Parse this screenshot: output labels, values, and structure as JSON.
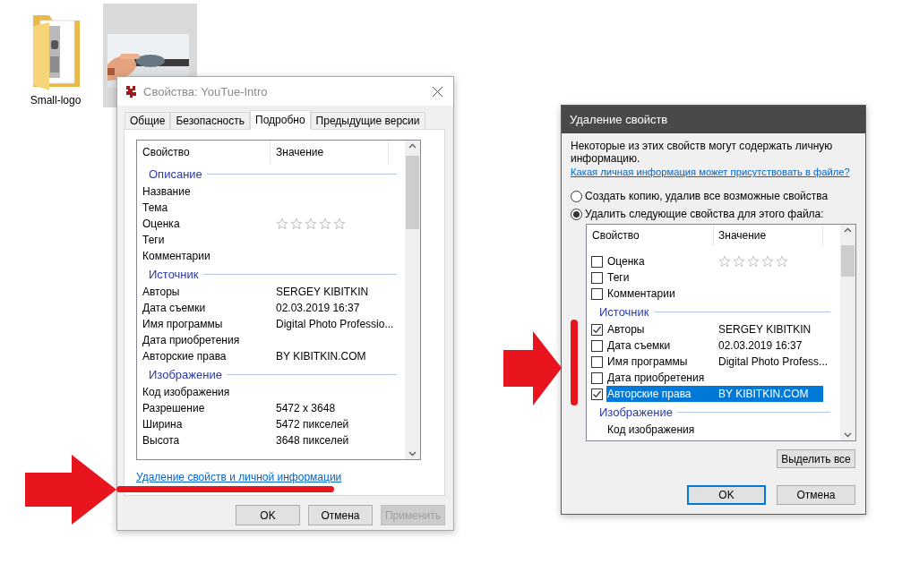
{
  "desktop": {
    "folder": {
      "label": "Small-logo"
    },
    "thumbnail": {
      "kind": "picture",
      "selected": true
    }
  },
  "properties_window": {
    "title": "Свойства: YouTue-Intro",
    "tabs": [
      {
        "label": "Общие",
        "selected": false
      },
      {
        "label": "Безопасность",
        "selected": false
      },
      {
        "label": "Подробно",
        "selected": true
      },
      {
        "label": "Предыдущие версии",
        "selected": false
      }
    ],
    "columns": [
      "Свойство",
      "Значение"
    ],
    "rows": [
      {
        "kind": "group",
        "label": "Описание"
      },
      {
        "kind": "property",
        "name": "Название"
      },
      {
        "kind": "property",
        "name": "Тема"
      },
      {
        "kind": "rating",
        "name": "Оценка",
        "stars": 0
      },
      {
        "kind": "property",
        "name": "Теги"
      },
      {
        "kind": "property",
        "name": "Комментарии"
      },
      {
        "kind": "group",
        "label": "Источник"
      },
      {
        "kind": "property",
        "name": "Авторы",
        "value": "SERGEY KIBITKIN"
      },
      {
        "kind": "property",
        "name": "Дата съемки",
        "value": "02.03.2019 16:37"
      },
      {
        "kind": "property",
        "name": "Имя программы",
        "value": "Digital Photo Professio..."
      },
      {
        "kind": "property",
        "name": "Дата приобретения"
      },
      {
        "kind": "property",
        "name": "Авторские права",
        "value": "BY KIBITKIN.COM"
      },
      {
        "kind": "group",
        "label": "Изображение"
      },
      {
        "kind": "property",
        "name": "Код изображения"
      },
      {
        "kind": "property",
        "name": "Разрешение",
        "value": "5472 x 3648"
      },
      {
        "kind": "property",
        "name": "Ширина",
        "value": "5472 пикселей"
      },
      {
        "kind": "property",
        "name": "Высота",
        "value": "3648 пикселей"
      }
    ],
    "link": "Удаление свойств и личной информации",
    "buttons": [
      {
        "label": "OK",
        "disabled": false
      },
      {
        "label": "Отмена",
        "disabled": false
      },
      {
        "label": "Применить",
        "disabled": true
      }
    ]
  },
  "remove_dialog": {
    "title": "Удаление свойств",
    "message": "Некоторые из этих свойств могут содержать личную информацию.",
    "link": "Какая личная информация может присутствовать в файле?",
    "options": [
      {
        "label": "Создать копию, удалив все возможные свойства",
        "selected": false
      },
      {
        "label": "Удалить следующие свойства для этого файла:",
        "selected": true
      }
    ],
    "columns": [
      "Свойство",
      "Значение"
    ],
    "rows": [
      {
        "kind": "rating",
        "name": "Оценка",
        "checked": false,
        "selected": false,
        "stars": 0
      },
      {
        "kind": "property",
        "name": "Теги",
        "checked": false,
        "selected": false
      },
      {
        "kind": "property",
        "name": "Комментарии",
        "checked": false,
        "selected": false
      },
      {
        "kind": "group",
        "label": "Источник"
      },
      {
        "kind": "property",
        "name": "Авторы",
        "value": "SERGEY KIBITKIN",
        "checked": true,
        "selected": false
      },
      {
        "kind": "property",
        "name": "Дата съемки",
        "value": "02.03.2019 16:37",
        "checked": false,
        "selected": false
      },
      {
        "kind": "property",
        "name": "Имя программы",
        "value": "Digital Photo Profess...",
        "checked": false,
        "selected": false
      },
      {
        "kind": "property",
        "name": "Дата приобретения",
        "checked": false,
        "selected": false
      },
      {
        "kind": "property",
        "name": "Авторские права",
        "value": "BY KIBITKIN.COM",
        "checked": true,
        "selected": true
      },
      {
        "kind": "group",
        "label": "Изображение"
      },
      {
        "kind": "label",
        "name": "Код изображения",
        "selected": false
      }
    ],
    "select_all": "Выделить все",
    "buttons": [
      {
        "label": "OK",
        "default": true
      },
      {
        "label": "Отмена",
        "default": false
      }
    ]
  }
}
